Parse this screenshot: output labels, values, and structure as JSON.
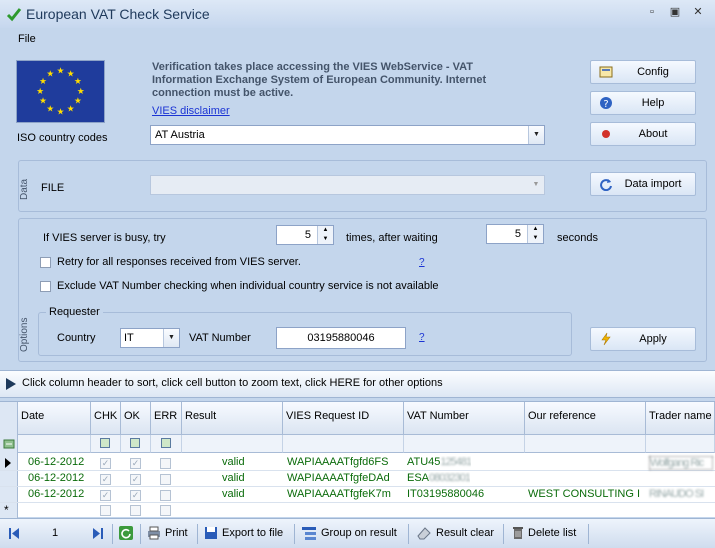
{
  "window": {
    "title": "European VAT Check Service",
    "minimize": "▫",
    "maximize": "▫",
    "close": "✕"
  },
  "menu": {
    "file": "File"
  },
  "info": {
    "text": "Verification takes place accessing the VIES WebService - VAT Information Exchange System of European Community. Internet connection must be active.",
    "disclaimer_link": "VIES disclaimer",
    "iso_label": "ISO country codes",
    "country_selected": "AT Austria"
  },
  "buttons": {
    "config": "Config",
    "help": "Help",
    "about": "About",
    "data_import": "Data import",
    "apply": "Apply"
  },
  "data_group": {
    "title": "Data",
    "file_label": "FILE"
  },
  "options_group": {
    "title": "Options",
    "busy_prefix": "If VIES server is busy, try",
    "tries": "5",
    "after_waiting": "times, after waiting",
    "wait": "5",
    "seconds": "seconds",
    "retry_label": "Retry for all responses received from VIES server.",
    "retry_help": "?",
    "exclude_label": "Exclude VAT Number checking when individual country service is not available",
    "requester_title": "Requester",
    "country_label": "Country",
    "country_value": "IT",
    "vat_label": "VAT Number",
    "vat_value": "03195880046",
    "vat_help": "?"
  },
  "hint": "Click column header to sort, click cell button to zoom text, click HERE for other options",
  "grid": {
    "headers": [
      "Date",
      "CHK",
      "OK",
      "ERR",
      "Result",
      "VIES Request ID",
      "VAT Number",
      "Our reference",
      "Trader name"
    ],
    "rows": [
      {
        "date": "06-12-2012",
        "result": "valid",
        "request_id": "WAPIAAAATfgfd6FS",
        "vat": "ATU45",
        "vat_blur": "125481",
        "ref": "",
        "trader": "Wolfgang Ric"
      },
      {
        "date": "06-12-2012",
        "result": "valid",
        "request_id": "WAPIAAAATfgfeDAd",
        "vat": "ESA",
        "vat_blur": "08032301",
        "ref": "",
        "trader": ""
      },
      {
        "date": "06-12-2012",
        "result": "valid",
        "request_id": "WAPIAAAATfgfeK7m",
        "vat": "IT03195880046",
        "vat_blur": "",
        "ref": "WEST CONSULTING I",
        "trader": "RINAUDO SI"
      }
    ]
  },
  "nav": {
    "page": "1",
    "print": "Print",
    "export": "Export to file",
    "group": "Group on result",
    "clear": "Result clear",
    "delete": "Delete list"
  }
}
